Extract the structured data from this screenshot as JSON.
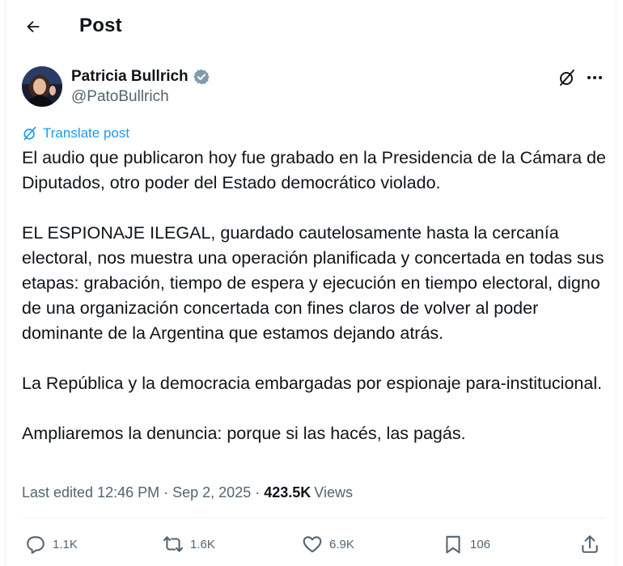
{
  "header": {
    "title": "Post"
  },
  "author": {
    "name": "Patricia Bullrich",
    "handle": "@PatoBullrich"
  },
  "translate_label": "Translate post",
  "post_text": "El audio que publicaron hoy fue grabado en la Presidencia de la Cámara de Diputados, otro poder del Estado democrático violado.\n\nEL ESPIONAJE ILEGAL, guardado cautelosamente hasta la cercanía electoral, nos muestra una operación planificada y concertada en todas sus etapas: grabación, tiempo de espera y ejecución en tiempo electoral, digno de una organización concertada con fines claros de volver al poder dominante de la Argentina que estamos dejando atrás.\n\nLa República y la democracia embargadas por espionaje para-institucional.\n\nAmpliaremos la denuncia: porque si las hacés, las pagás.",
  "meta": {
    "edited": "Last edited 12:46 PM",
    "sep1": " · ",
    "date": "Sep 2, 2025",
    "sep2": " · ",
    "views_count": "423.5K",
    "views_label": "Views"
  },
  "actions": {
    "replies": "1.1K",
    "reposts": "1.6K",
    "likes": "6.9K",
    "bookmarks": "106"
  },
  "colors": {
    "accent": "#1d9bf0",
    "text": "#0f1419",
    "secondary": "#536471",
    "verified": "#829aab"
  },
  "icons": [
    "back-arrow-icon",
    "verified-badge-icon",
    "grok-icon",
    "more-icon",
    "translate-icon",
    "reply-icon",
    "repost-icon",
    "like-icon",
    "bookmark-icon",
    "share-icon"
  ]
}
